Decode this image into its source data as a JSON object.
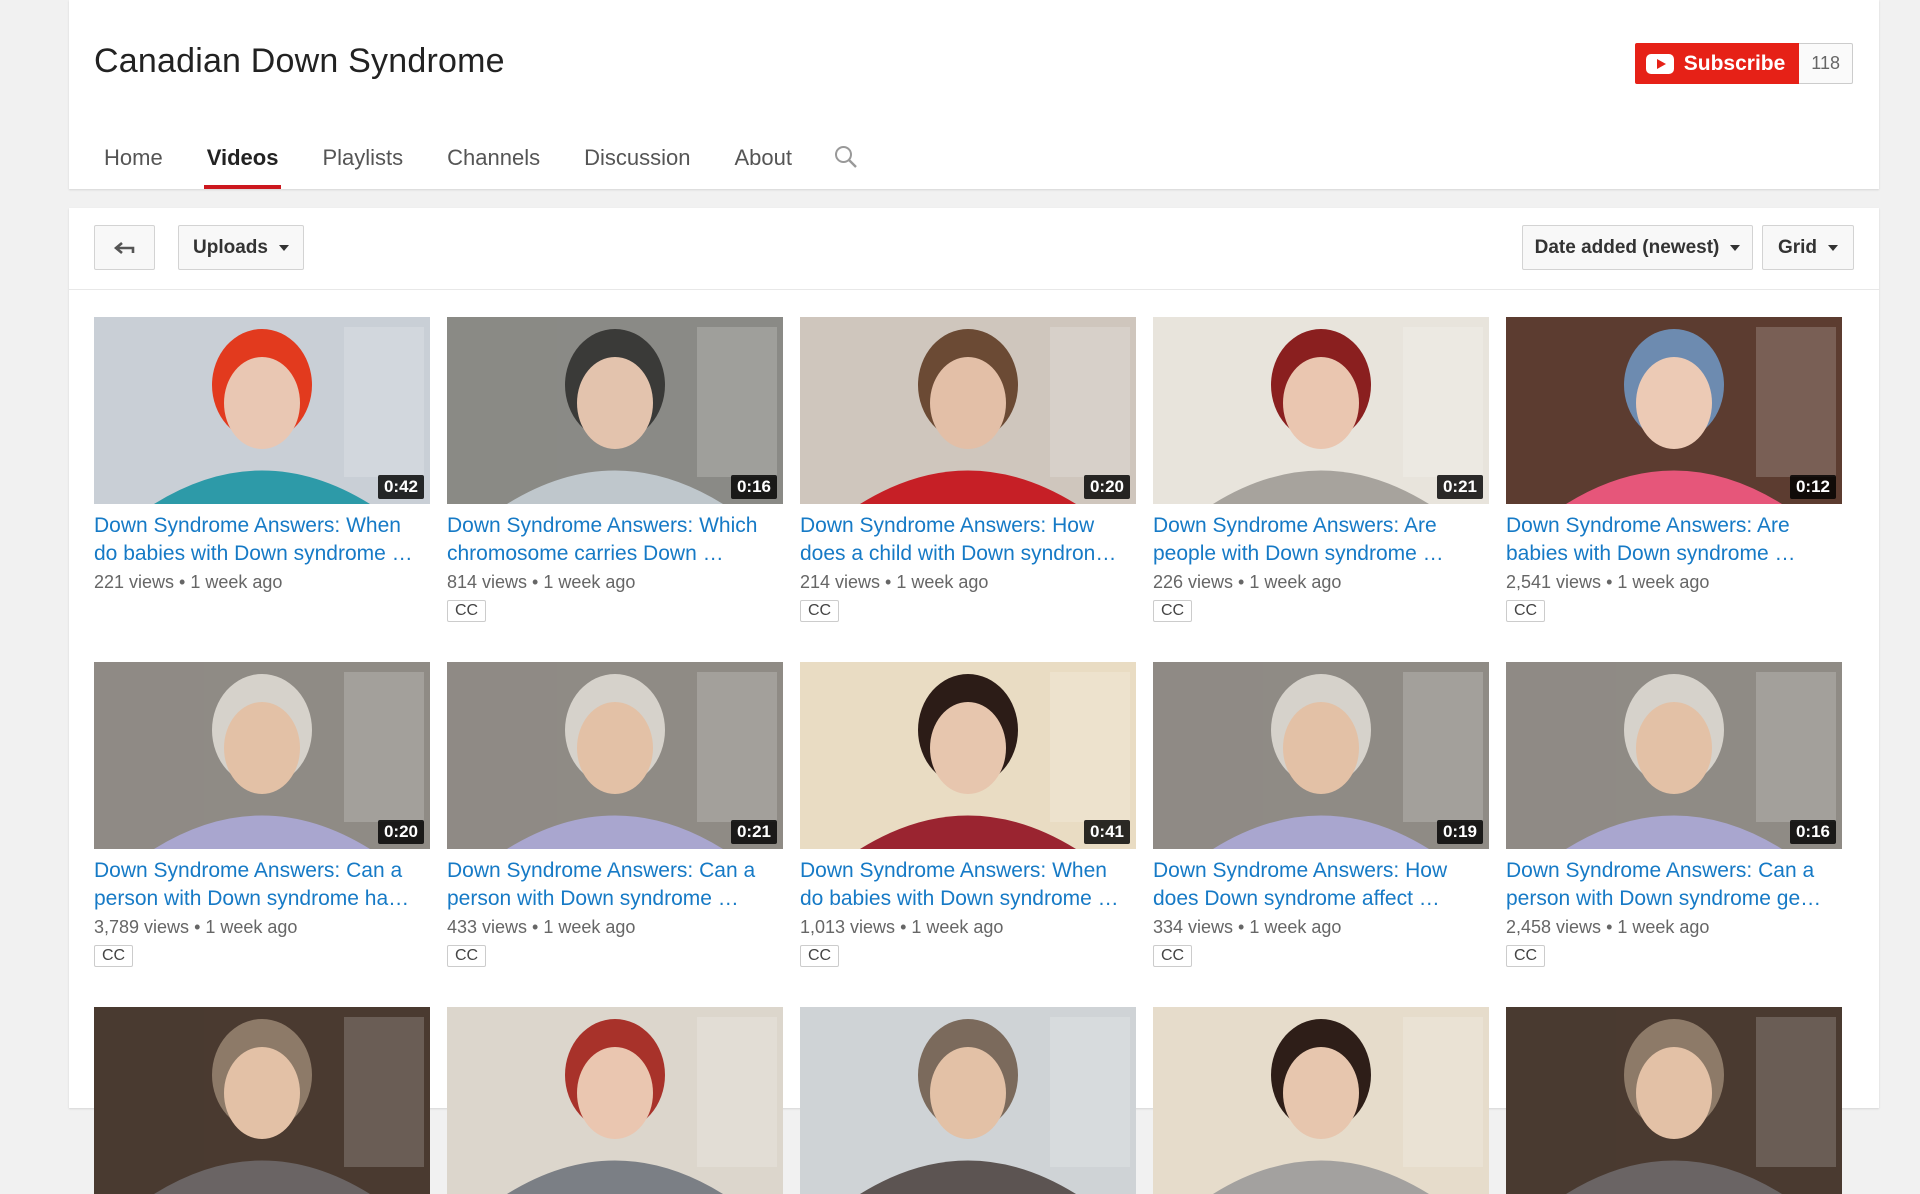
{
  "channel": {
    "title": "Canadian Down Syndrome"
  },
  "subscribe": {
    "label": "Subscribe",
    "count": "118"
  },
  "tabs": [
    "Home",
    "Videos",
    "Playlists",
    "Channels",
    "Discussion",
    "About"
  ],
  "active_tab": "Videos",
  "toolbar": {
    "uploads": "Uploads",
    "sort": "Date added (newest)",
    "view": "Grid"
  },
  "colors": {
    "accent": "#e62117",
    "link": "#167ac6",
    "tab_underline": "#cc181e"
  },
  "videos": [
    {
      "title": "Down Syndrome Answers: When do babies with Down syndrome …",
      "duration": "0:42",
      "views": "221 views",
      "age": "1 week ago",
      "cc": ""
    },
    {
      "title": "Down Syndrome Answers: Which chromosome carries Down …",
      "duration": "0:16",
      "views": "814 views",
      "age": "1 week ago",
      "cc": "CC"
    },
    {
      "title": "Down Syndrome Answers: How does a child with Down syndron…",
      "duration": "0:20",
      "views": "214 views",
      "age": "1 week ago",
      "cc": "CC"
    },
    {
      "title": "Down Syndrome Answers: Are people with Down syndrome …",
      "duration": "0:21",
      "views": "226 views",
      "age": "1 week ago",
      "cc": "CC"
    },
    {
      "title": "Down Syndrome Answers: Are babies with Down syndrome …",
      "duration": "0:12",
      "views": "2,541 views",
      "age": "1 week ago",
      "cc": "CC"
    },
    {
      "title": "Down Syndrome Answers: Can a person with Down syndrome ha…",
      "duration": "0:20",
      "views": "3,789 views",
      "age": "1 week ago",
      "cc": "CC"
    },
    {
      "title": "Down Syndrome Answers: Can a person with Down syndrome …",
      "duration": "0:21",
      "views": "433 views",
      "age": "1 week ago",
      "cc": "CC"
    },
    {
      "title": "Down Syndrome Answers: When do babies with Down syndrome …",
      "duration": "0:41",
      "views": "1,013 views",
      "age": "1 week ago",
      "cc": "CC"
    },
    {
      "title": "Down Syndrome Answers: How does Down syndrome affect …",
      "duration": "0:19",
      "views": "334 views",
      "age": "1 week ago",
      "cc": "CC"
    },
    {
      "title": "Down Syndrome Answers: Can a person with Down syndrome ge…",
      "duration": "0:16",
      "views": "2,458 views",
      "age": "1 week ago",
      "cc": "CC"
    },
    {
      "title": "",
      "duration": "",
      "views": "",
      "age": "",
      "cc": ""
    },
    {
      "title": "",
      "duration": "",
      "views": "",
      "age": "",
      "cc": ""
    },
    {
      "title": "",
      "duration": "",
      "views": "",
      "age": "",
      "cc": ""
    },
    {
      "title": "",
      "duration": "",
      "views": "",
      "age": "",
      "cc": ""
    },
    {
      "title": "",
      "duration": "",
      "views": "",
      "age": "",
      "cc": ""
    }
  ]
}
